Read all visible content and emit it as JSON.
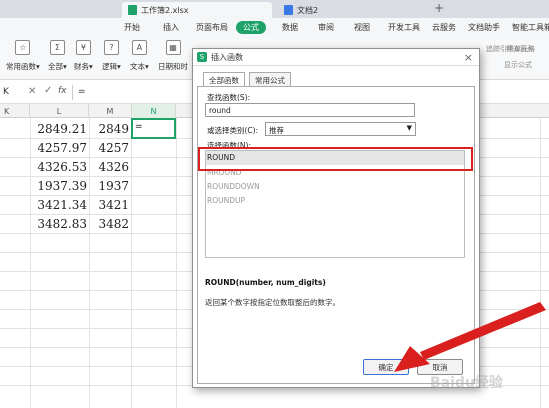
{
  "tabs": [
    {
      "label": "工作簿2.xlsx",
      "active": true
    },
    {
      "label": "文档2",
      "active": false
    }
  ],
  "new_tab": "+",
  "menu": [
    "开始",
    "插入",
    "页面布局",
    "公式",
    "数据",
    "审阅",
    "视图",
    "开发工具",
    "云服务",
    "文档助手",
    "智能工具箱"
  ],
  "active_menu": "公式",
  "ribbon": {
    "buttons": [
      {
        "label": "常用函数▾",
        "icon": "star-icon"
      },
      {
        "label": "全部▾",
        "icon": "sigma-icon"
      },
      {
        "label": "财务▾",
        "icon": "finance-icon"
      },
      {
        "label": "逻辑▾",
        "icon": "logic-icon"
      },
      {
        "label": "文本▾",
        "icon": "text-icon"
      },
      {
        "label": "日期和时",
        "icon": "calendar-icon"
      }
    ],
    "right_items": [
      "追踪引用单元格",
      "移去箭头",
      "显示公式"
    ]
  },
  "formula_bar": {
    "name_box": "K",
    "fx": "fx",
    "content": "="
  },
  "columns": [
    "K",
    "L",
    "M",
    "N"
  ],
  "cells": {
    "L": [
      "2849.21",
      "4257.97",
      "4326.53",
      "1937.39",
      "3421.34",
      "3482.83"
    ],
    "M": [
      "2849",
      "4257",
      "4326",
      "1937",
      "3421",
      "3482"
    ],
    "N": [
      "="
    ]
  },
  "dialog": {
    "title": "插入函数",
    "close": "×",
    "tab_all": "全部函数",
    "tab_common": "常用公式",
    "search_label": "查找函数(S):",
    "search_value": "round",
    "category_label": "或选择类别(C):",
    "category_value": "推荐",
    "select_label": "选择函数(N):",
    "functions": [
      "ROUND",
      "MROUND",
      "ROUNDDOWN",
      "ROUNDUP"
    ],
    "signature": "ROUND(number, num_digits)",
    "description": "返回某个数字按指定位数取整后的数字。",
    "ok": "确定",
    "cancel": "取消"
  },
  "colors": {
    "accent": "#1ea26a",
    "highlight_box": "#d9201e",
    "arrow": "#d9201e"
  },
  "watermark": "Baidu经验"
}
